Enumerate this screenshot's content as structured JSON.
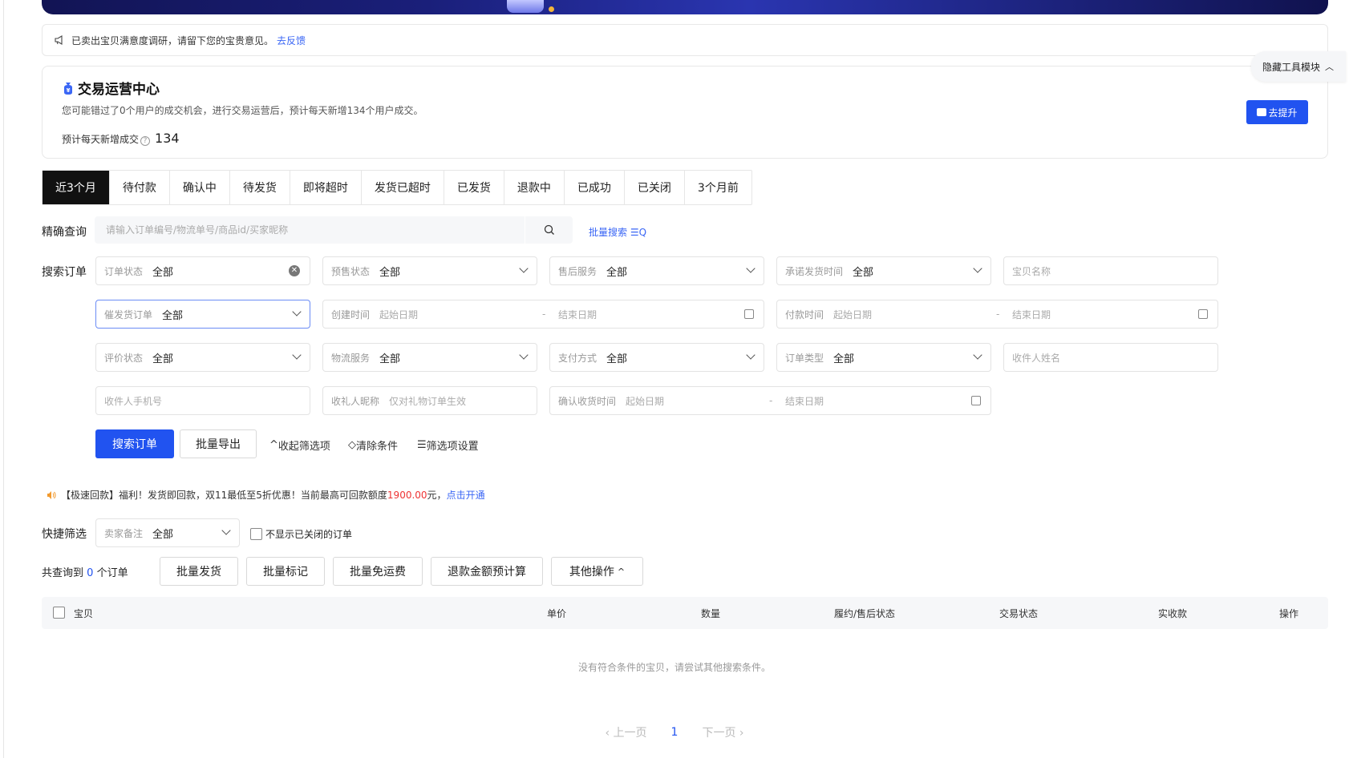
{
  "notice": {
    "text": "已卖出宝贝满意度调研，请留下您的宝贵意见。",
    "link": "去反馈"
  },
  "ops_center": {
    "title": "交易运营中心",
    "desc": "您可能错过了0个用户的成交机会，进行交易运营后，预计每天新增134个用户成交。",
    "stat_label": "预计每天新增成交",
    "stat_value": "134",
    "button": "去提升"
  },
  "hide_tool": "隐藏工具模块",
  "tabs": [
    "近3个月",
    "待付款",
    "确认中",
    "待发货",
    "即将超时",
    "发货已超时",
    "已发货",
    "退款中",
    "已成功",
    "已关闭",
    "3个月前"
  ],
  "exact_query": {
    "label": "精确查询",
    "placeholder": "请输入订单编号/物流单号/商品id/买家昵称",
    "batch_search": "批量搜索"
  },
  "search_orders_label": "搜索订单",
  "filters": {
    "order_status": {
      "k": "订单状态",
      "v": "全部"
    },
    "presale_status": {
      "k": "预售状态",
      "v": "全部"
    },
    "after_sale": {
      "k": "售后服务",
      "v": "全部"
    },
    "promise_time": {
      "k": "承诺发货时间",
      "v": "全部"
    },
    "item_name": {
      "ph": "宝贝名称"
    },
    "urge_ship": {
      "k": "催发货订单",
      "v": "全部"
    },
    "create_time": {
      "k": "创建时间",
      "start": "起始日期",
      "sep": "-",
      "end": "结束日期"
    },
    "pay_time": {
      "k": "付款时间",
      "start": "起始日期",
      "sep": "-",
      "end": "结束日期"
    },
    "review_status": {
      "k": "评价状态",
      "v": "全部"
    },
    "logistics": {
      "k": "物流服务",
      "v": "全部"
    },
    "pay_method": {
      "k": "支付方式",
      "v": "全部"
    },
    "order_type": {
      "k": "订单类型",
      "v": "全部"
    },
    "receiver_name": {
      "ph": "收件人姓名"
    },
    "receiver_phone": {
      "ph": "收件人手机号"
    },
    "gift_nick": {
      "k": "收礼人昵称",
      "ph": "仅对礼物订单生效"
    },
    "confirm_time": {
      "k": "确认收货时间",
      "start": "起始日期",
      "sep": "-",
      "end": "结束日期"
    }
  },
  "actions": {
    "search": "搜索订单",
    "export": "批量导出",
    "collapse": "收起筛选项",
    "clear": "清除条件",
    "settings": "筛选项设置"
  },
  "promo": {
    "prefix": "【极速回款】福利！发货即回款，双11最低至5折优惠！当前最高可回款额度",
    "amount": "1900.00",
    "suffix": "元，",
    "link": "点击开通"
  },
  "quick_filter": {
    "label": "快捷筛选",
    "seller_note": {
      "k": "卖家备注",
      "v": "全部"
    },
    "hide_closed": "不显示已关闭的订单"
  },
  "result": {
    "prefix": "共查询到",
    "count": "0",
    "suffix": "个订单"
  },
  "batch_buttons": [
    "批量发货",
    "批量标记",
    "批量免运费",
    "退款金额预计算",
    "其他操作"
  ],
  "table_headers": [
    "宝贝",
    "单价",
    "数量",
    "履约/售后状态",
    "交易状态",
    "实收款",
    "操作"
  ],
  "empty_text": "没有符合条件的宝贝，请尝试其他搜索条件。",
  "pager": {
    "prev": "上一页",
    "current": "1",
    "next": "下一页"
  }
}
